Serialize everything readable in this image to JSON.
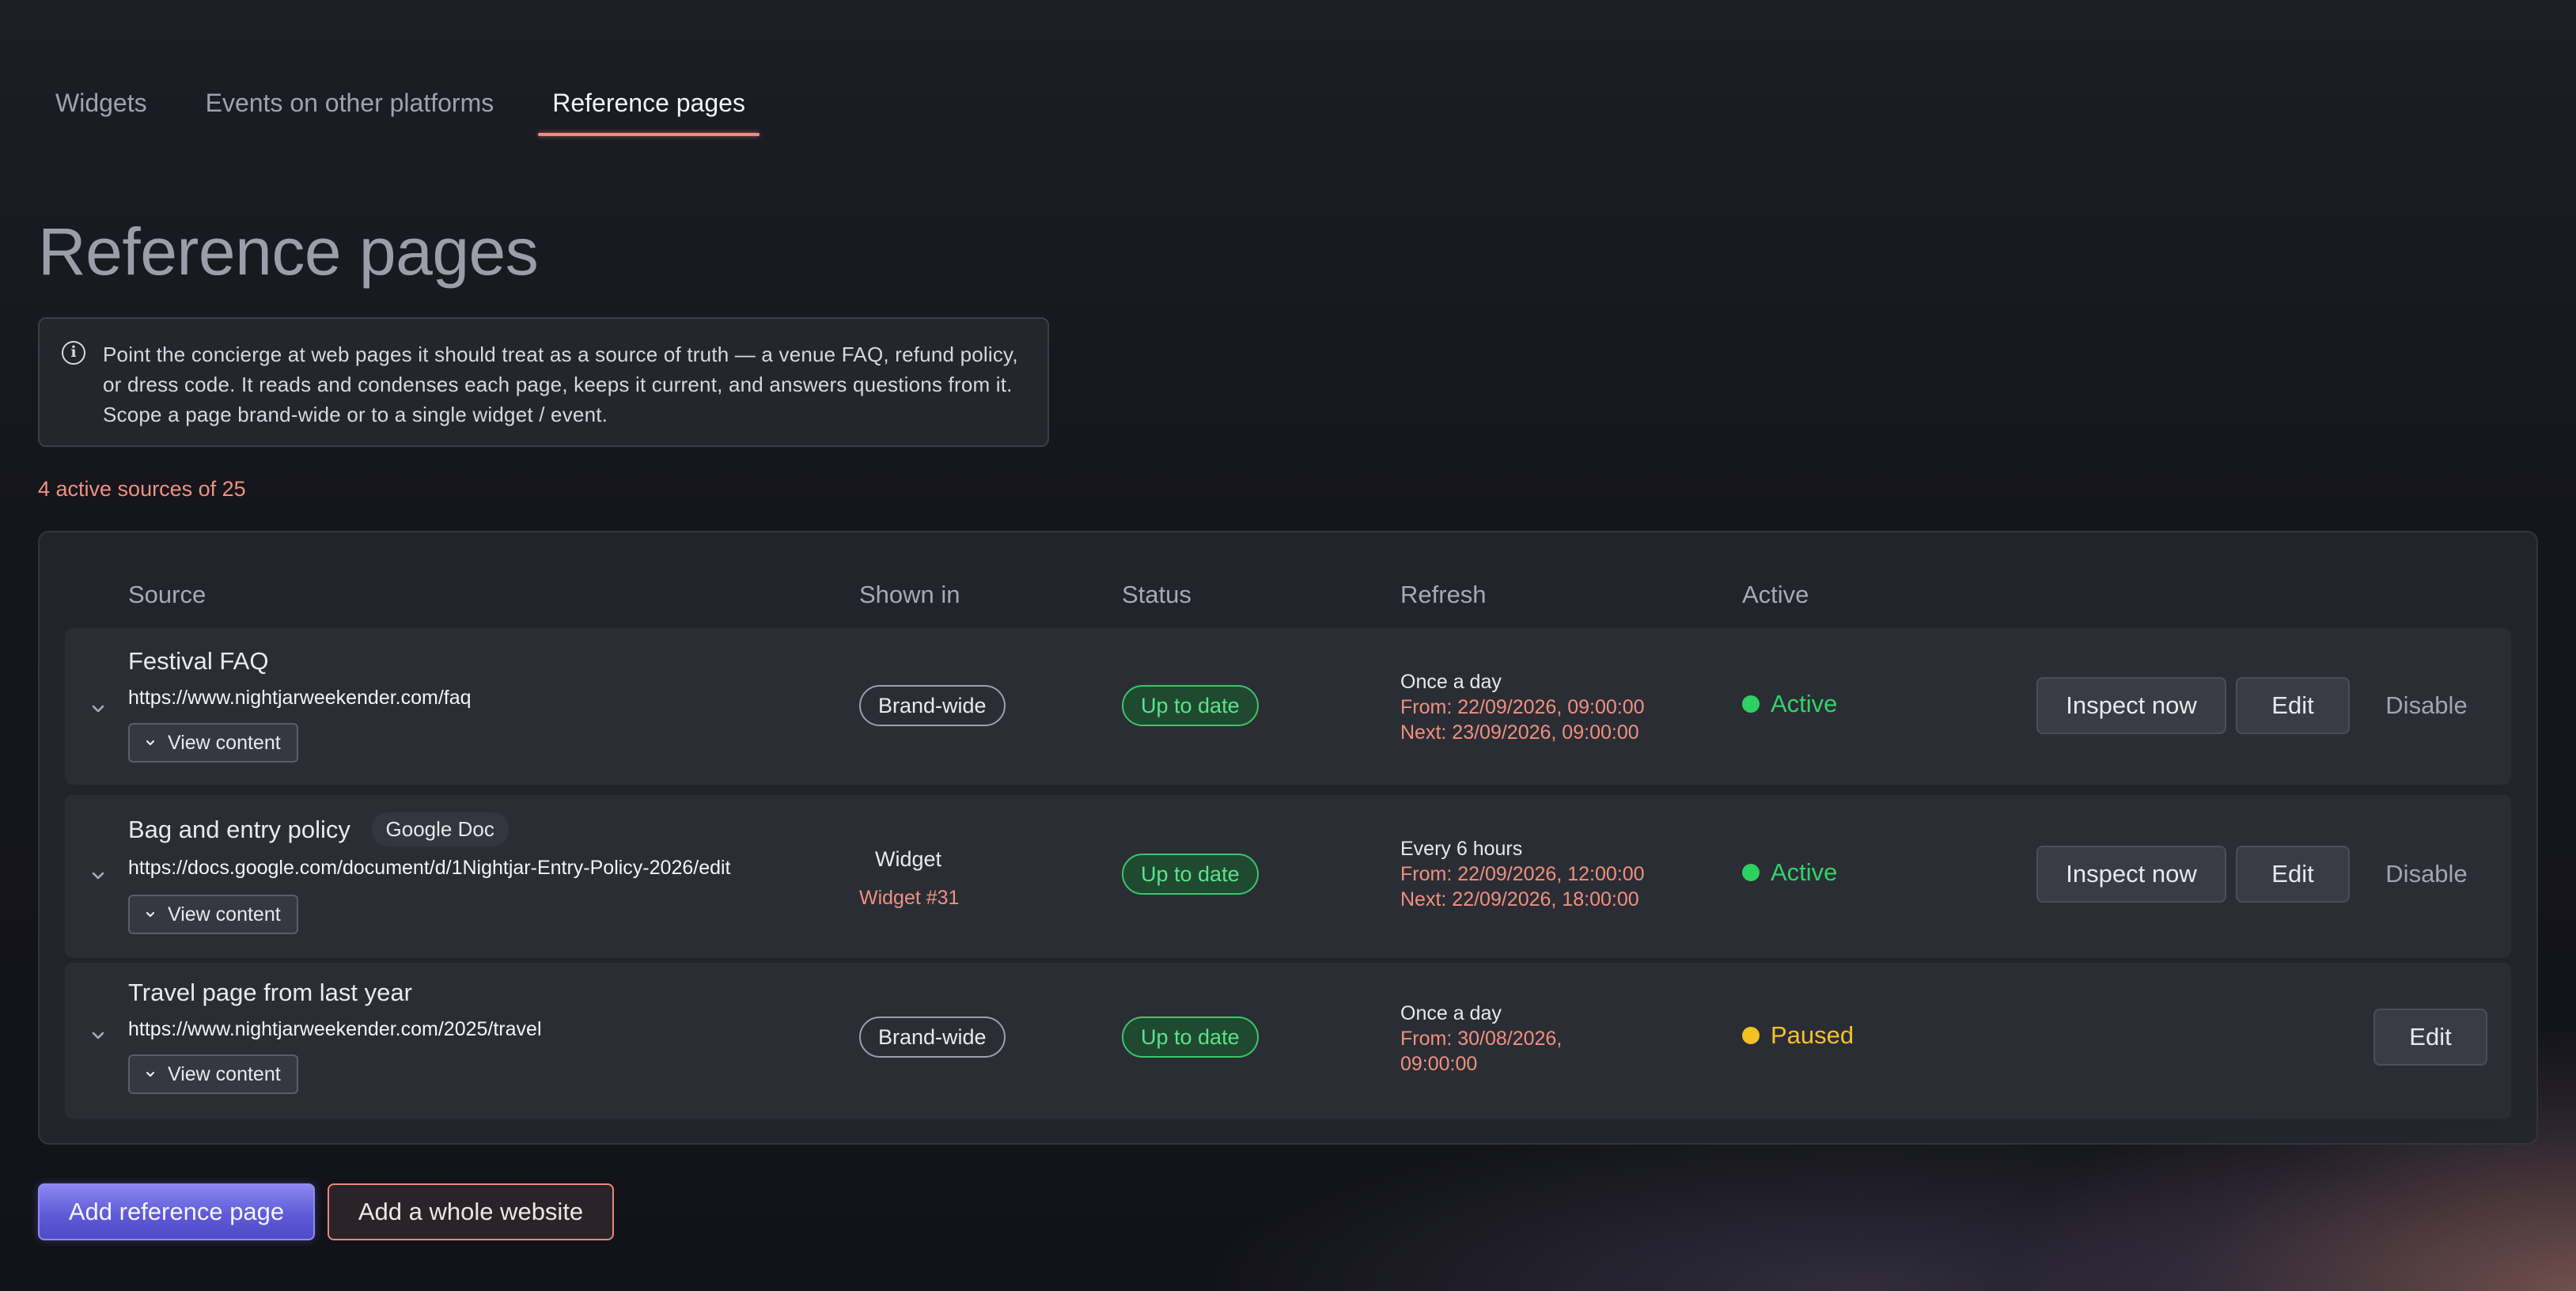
{
  "tabs": [
    {
      "label": "Widgets",
      "active": false
    },
    {
      "label": "Events on other platforms",
      "active": false
    },
    {
      "label": "Reference pages",
      "active": true
    }
  ],
  "page": {
    "title": "Reference pages",
    "info_text": "Point the concierge at web pages it should treat as a source of truth — a venue FAQ, refund policy, or dress code. It reads and condenses each page, keeps it current, and answers questions from it. Scope a page brand-wide or to a single widget / event.",
    "count_text": "4 active sources of 25"
  },
  "table": {
    "headers": {
      "source": "Source",
      "shown_in": "Shown in",
      "status": "Status",
      "refresh": "Refresh",
      "active": "Active"
    },
    "rows": [
      {
        "title": "Festival FAQ",
        "url": "https://www.nightjarweekender.com/faq",
        "view_label": "View content",
        "shown_in": "Brand-wide",
        "status": "Up to date",
        "refresh_freq": "Once a day",
        "refresh_from": "From: 22/09/2026, 09:00:00",
        "refresh_next": "Next: 23/09/2026, 09:00:00",
        "state": "Active",
        "inspect_label": "Inspect now",
        "edit_label": "Edit",
        "disable_label": "Disable"
      },
      {
        "title": "Bag and entry policy",
        "badge": "Google Doc",
        "url": "https://docs.google.com/document/d/1Nightjar-Entry-Policy-2026/edit",
        "view_label": "View content",
        "shown_in": "Widget",
        "shown_in_detail": "Widget #31",
        "status": "Up to date",
        "refresh_freq": "Every 6 hours",
        "refresh_from": "From: 22/09/2026, 12:00:00",
        "refresh_next": "Next: 22/09/2026, 18:00:00",
        "state": "Active",
        "inspect_label": "Inspect now",
        "edit_label": "Edit",
        "disable_label": "Disable"
      },
      {
        "title": "Travel page from last year",
        "url": "https://www.nightjarweekender.com/2025/travel",
        "view_label": "View content",
        "shown_in": "Brand-wide",
        "status": "Up to date",
        "refresh_freq": "Once a day",
        "refresh_from_line1": "From: 30/08/2026,",
        "refresh_from_line2": "09:00:00",
        "state": "Paused",
        "edit_label": "Edit"
      }
    ]
  },
  "actions": {
    "add_reference": "Add reference page",
    "add_website": "Add a whole website"
  },
  "colors": {
    "accent": "#f0907f",
    "active_green": "#32d36a",
    "paused_yellow": "#f3c22b",
    "primary_button": "#5f5bd8"
  }
}
